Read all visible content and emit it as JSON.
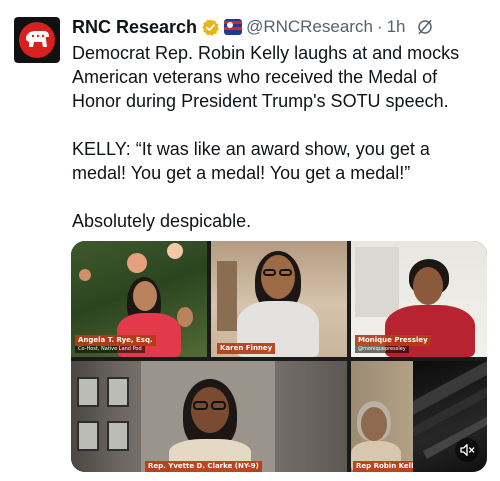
{
  "tweet": {
    "author_name": "RNC Research",
    "handle": "@RNCResearch",
    "separator": "·",
    "time": "1h",
    "lines": [
      "Democrat Rep. Robin Kelly laughs at and mocks",
      "American veterans who received the Medal of",
      "Honor during President Trump's SOTU speech."
    ],
    "quote_lines": [
      "KELLY: “It was like an award show, you get a",
      "medal! You get a medal! You get a medal!”"
    ],
    "closing": "Absolutely despicable."
  },
  "video": {
    "participants": [
      {
        "name": "Angela T. Rye, Esq.",
        "subtitle": "Co-Host, Native Land Pod"
      },
      {
        "name": "Karen Finney"
      },
      {
        "name": "Monique Pressley",
        "subtitle": "@moniquepressley"
      },
      {
        "name": "Rep. Yvette D. Clarke (NY-9)"
      },
      {
        "name": "Rep Robin Kelly"
      }
    ]
  },
  "colors": {
    "text": "#0f1419",
    "secondary": "#536471",
    "verified": "#e8b417",
    "brand_red": "#d8201f",
    "label_bg": "#b43c14"
  },
  "icons": [
    "rnc-logo-icon",
    "verified-badge-icon",
    "affiliation-flag-icon",
    "grok-icon",
    "mute-icon"
  ]
}
